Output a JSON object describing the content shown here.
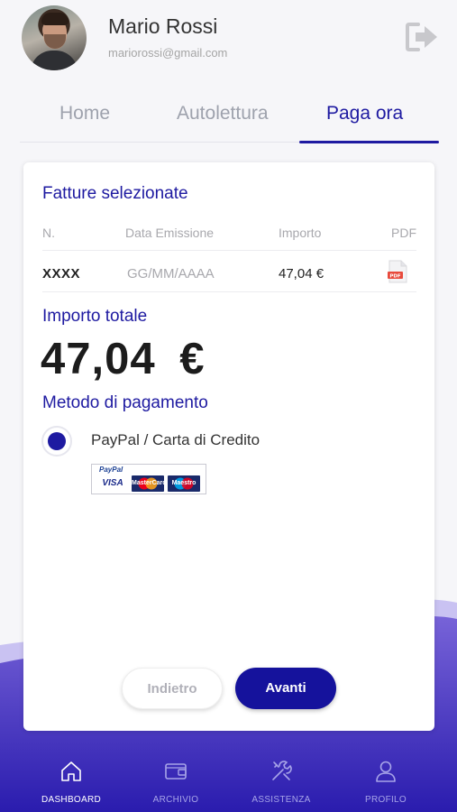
{
  "header": {
    "user_name": "Mario Rossi",
    "user_email": "mariorossi@gmail.com",
    "logout_icon": "logout-icon"
  },
  "tabs": [
    {
      "label": "Home",
      "active": false
    },
    {
      "label": "Autolettura",
      "active": false
    },
    {
      "label": "Paga ora",
      "active": true
    }
  ],
  "invoices": {
    "title": "Fatture selezionate",
    "columns": [
      "N.",
      "Data Emissione",
      "Importo",
      "PDF"
    ],
    "rows": [
      {
        "number": "XXXX",
        "date": "GG/MM/AAAA",
        "amount": "47,04 €",
        "pdf_icon": "pdf-file-icon"
      }
    ]
  },
  "total": {
    "label": "Importo totale",
    "amount": "47,04  €"
  },
  "payment": {
    "label": "Metodo di pagamento",
    "option_label": "PayPal / Carta di Credito",
    "selected": true,
    "logo_text": {
      "paypal": "PayPal",
      "visa": "VISA",
      "mastercard": "MasterCard",
      "maestro": "Maestro"
    }
  },
  "actions": {
    "back_label": "Indietro",
    "next_label": "Avanti"
  },
  "bottom_nav": [
    {
      "label": "DASHBOARD",
      "icon": "home-icon",
      "active": true
    },
    {
      "label": "ARCHIVIO",
      "icon": "wallet-icon",
      "active": false
    },
    {
      "label": "ASSISTENZA",
      "icon": "tools-icon",
      "active": false
    },
    {
      "label": "PROFILO",
      "icon": "user-icon",
      "active": false
    }
  ],
  "colors": {
    "accent": "#1e1aa1",
    "nav_background": "#2d1fb0",
    "wave_light": "#9d8fe6"
  }
}
